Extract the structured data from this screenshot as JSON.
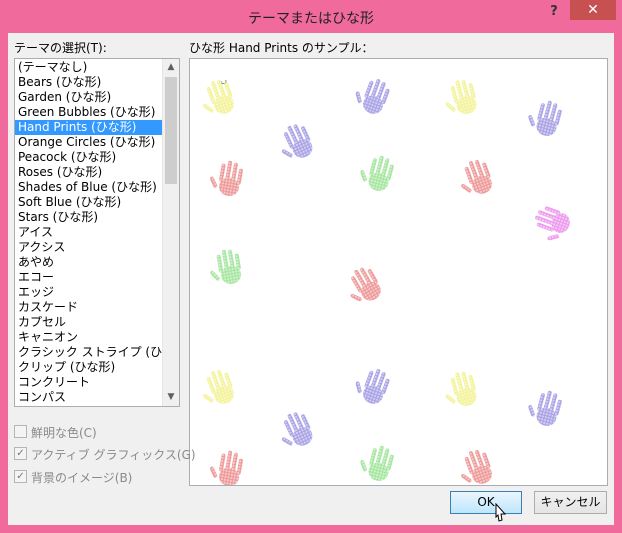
{
  "window": {
    "title": "テーマまたはひな形",
    "help_label": "?",
    "close_label": "✕",
    "border_color": "#f06a9b"
  },
  "theme_list": {
    "label": "テーマの選択(T):",
    "items": [
      "(テーマなし)",
      "Bears (ひな形)",
      "Garden (ひな形)",
      "Green Bubbles (ひな形)",
      "Hand Prints (ひな形)",
      "Orange Circles (ひな形)",
      "Peacock (ひな形)",
      "Roses (ひな形)",
      "Shades of Blue (ひな形)",
      "Soft Blue (ひな形)",
      "Stars (ひな形)",
      "アイス",
      "アクシス",
      "あやめ",
      "エコー",
      "エッジ",
      "カスケード",
      "カプセル",
      "キャニオン",
      "クラシック ストライプ (ひな形)",
      "クリップ (ひな形)",
      "コンクリート",
      "コンパス"
    ],
    "selected_index": 4
  },
  "preview": {
    "label": "ひな形 Hand Prints のサンプル：",
    "paragraph_mark": "↵",
    "hand_colors": {
      "yellow": "#f3f39a",
      "purple": "#aaa3e6",
      "pink": "#ee9a9a",
      "green": "#a6e6a0",
      "magenta": "#ee9aee"
    }
  },
  "options": [
    {
      "label": "鮮明な色(C)",
      "checked": false
    },
    {
      "label": "アクティブ グラフィックス(G)",
      "checked": true
    },
    {
      "label": "背景のイメージ(B)",
      "checked": true
    }
  ],
  "buttons": {
    "ok": "OK",
    "cancel": "キャンセル"
  }
}
